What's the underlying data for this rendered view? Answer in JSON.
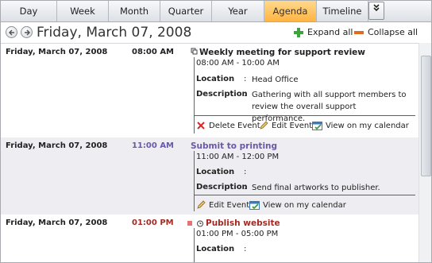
{
  "tabs": [
    {
      "label": "Day",
      "active": false
    },
    {
      "label": "Week",
      "active": false
    },
    {
      "label": "Month",
      "active": false
    },
    {
      "label": "Quarter",
      "active": false
    },
    {
      "label": "Year",
      "active": false
    },
    {
      "label": "Agenda",
      "active": true
    },
    {
      "label": "Timeline",
      "active": false
    }
  ],
  "header": {
    "date_title": "Friday, March 07, 2008",
    "expand_label": "Expand all",
    "collapse_label": "Collapse all"
  },
  "colors": {
    "accent_tab": "#ffb443",
    "time_am": "#222222",
    "time_purple": "#6a58a8",
    "time_red": "#a02a24"
  },
  "events": [
    {
      "date": "Friday, March 07, 2008",
      "time": "08:00 AM",
      "title": "Weekly meeting for support review",
      "range": "08:00 AM - 10:00 AM",
      "location_label": "Location",
      "location_value": "Head Office",
      "description_label": "Description",
      "description_value": "Gathering with all support members to review the overall support performance.",
      "actions": [
        "Delete Event",
        "Edit Event",
        "View on my calendar"
      ]
    },
    {
      "date": "Friday, March 07, 2008",
      "time": "11:00 AM",
      "title": "Submit to printing",
      "range": "11:00 AM - 12:00 PM",
      "location_label": "Location",
      "location_value": "",
      "description_label": "Description",
      "description_value": "Send final artworks to publisher.",
      "actions": [
        "Edit Event",
        "View on my calendar"
      ]
    },
    {
      "date": "Friday, March 07, 2008",
      "time": "01:00 PM",
      "title": "Publish website",
      "range": "01:00 PM - 05:00 PM",
      "location_label": "Location",
      "location_value": ""
    }
  ]
}
